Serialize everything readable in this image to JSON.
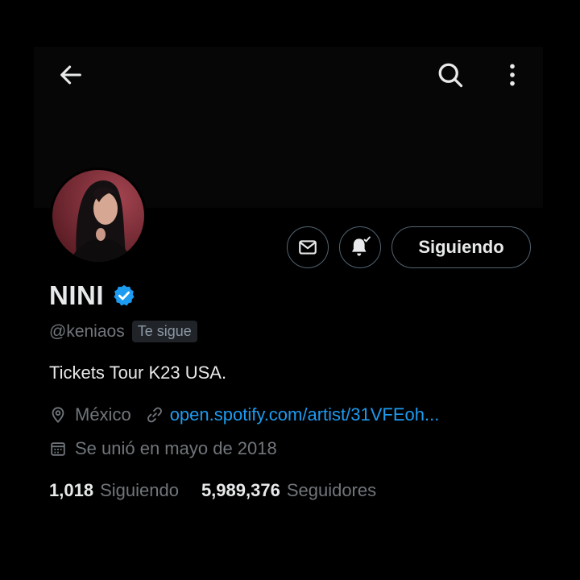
{
  "header": {
    "back_icon": "arrow-left-icon",
    "search_icon": "search-icon",
    "more_icon": "more-vertical-icon"
  },
  "profile": {
    "name": "NINI",
    "handle": "@keniaos",
    "follows_you": "Te sigue",
    "bio": "Tickets Tour K23 USA.",
    "location": "México",
    "website": "open.spotify.com/artist/31VFEoh...",
    "joined": "Se unió en mayo de 2018",
    "verified": true
  },
  "actions": {
    "message_icon": "mail-icon",
    "notification_icon": "bell-check-icon",
    "follow_label": "Siguiendo"
  },
  "stats": {
    "following_count": "1,018",
    "following_label": "Siguiendo",
    "followers_count": "5,989,376",
    "followers_label": "Seguidores"
  },
  "colors": {
    "background": "#000000",
    "text_primary": "#e7e9ea",
    "text_secondary": "#71767b",
    "accent": "#1d9bf0",
    "border": "#536471"
  }
}
